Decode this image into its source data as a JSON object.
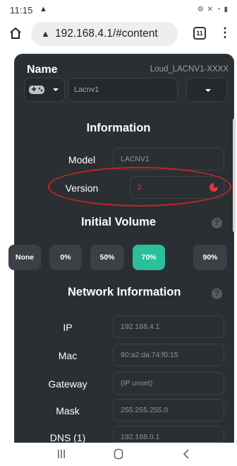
{
  "status": {
    "time": "11:15",
    "warning": "▲",
    "system_icons": "⚙ ✕ ◔ ▮"
  },
  "browser": {
    "url": "192.168.4.1/#content",
    "tab_count": "11"
  },
  "device": {
    "name_label": "Name",
    "device_id": "Loud_LACNV1-XXXX",
    "name_value": "Lacnv1"
  },
  "information": {
    "title": "Information",
    "model_label": "Model",
    "model_value": "LACNV1",
    "version_label": "Version",
    "version_value": "2"
  },
  "volume": {
    "title": "Initial Volume",
    "options": [
      "None",
      "0%",
      "50%",
      "70%",
      "90%"
    ],
    "selected": "70%"
  },
  "network": {
    "title": "Network Information",
    "rows": [
      {
        "label": "IP",
        "value": "192.168.4.1"
      },
      {
        "label": "Mac",
        "value": "90:a2:da:74:f0:15"
      },
      {
        "label": "Gateway",
        "value": "(IP unset)"
      },
      {
        "label": "Mask",
        "value": "255.255.255.0"
      },
      {
        "label": "DNS (1)",
        "value": "192.168.0.1"
      }
    ]
  },
  "colors": {
    "panel": "#2a2f33",
    "accent": "#2bbf9c",
    "annotation": "#cc2222",
    "version_text": "#e53935"
  }
}
